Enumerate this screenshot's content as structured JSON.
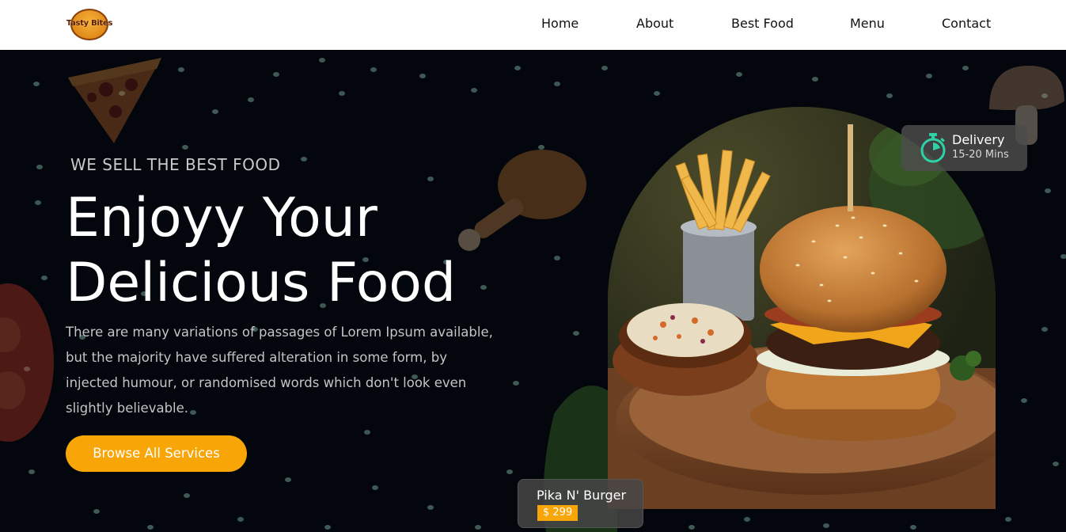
{
  "brand": {
    "logo_text": "Tasty Bites"
  },
  "nav": {
    "items": [
      {
        "label": "Home"
      },
      {
        "label": "About"
      },
      {
        "label": "Best Food"
      },
      {
        "label": "Menu"
      },
      {
        "label": "Contact"
      }
    ]
  },
  "hero": {
    "eyebrow": "WE SELL THE BEST FOOD",
    "headline_line1": "Enjoyy Your",
    "headline_line2": "Delicious Food",
    "description": "There are many variations of passages of Lorem Ipsum available, but the majority have suffered alteration in some form, by injected humour, or randomised words which don't look even slightly believable.",
    "cta_label": "Browse All Services"
  },
  "delivery": {
    "title": "Delivery",
    "time": "15-20 Mins",
    "icon": "stopwatch-icon"
  },
  "featured": {
    "name": "Pika N' Burger",
    "price": "$ 299"
  },
  "colors": {
    "accent": "#f7a507",
    "background": "#03060c",
    "timer": "#2fd1a6"
  }
}
